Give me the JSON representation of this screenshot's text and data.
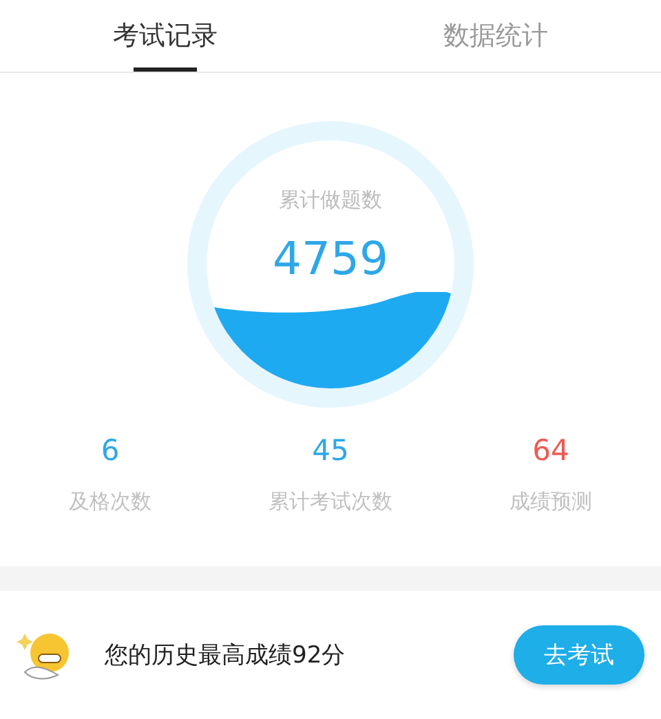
{
  "tabs": [
    {
      "label": "考试记录",
      "selected": true
    },
    {
      "label": "数据统计",
      "selected": false
    }
  ],
  "gauge": {
    "label": "累计做题数",
    "value": "4759"
  },
  "stats": [
    {
      "value": "6",
      "label": "及格次数",
      "color": "#2ea7e8"
    },
    {
      "value": "45",
      "label": "累计考试次数",
      "color": "#2ea7e8"
    },
    {
      "value": "64",
      "label": "成绩预测",
      "color": "#ef5a55"
    }
  ],
  "best": {
    "text": "您的历史最高成绩92分",
    "button": "去考试"
  }
}
